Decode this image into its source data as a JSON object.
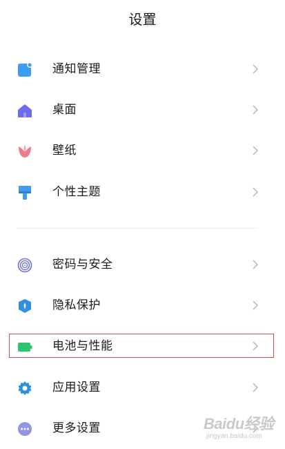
{
  "header": {
    "title": "设置"
  },
  "settings": {
    "items": [
      {
        "label": "通知管理",
        "icon": "notification-icon",
        "color": "#3d9bf2"
      },
      {
        "label": "桌面",
        "icon": "home-icon",
        "color": "#6c6cf0"
      },
      {
        "label": "壁纸",
        "icon": "tulip-icon",
        "color": "#f07a8a"
      },
      {
        "label": "个性主题",
        "icon": "brush-icon",
        "color": "#3d9bf2"
      },
      {
        "label": "密码与安全",
        "icon": "fingerprint-icon",
        "color": "#7a7fd0"
      },
      {
        "label": "隐私保护",
        "icon": "privacy-shield-icon",
        "color": "#2f8fe0"
      },
      {
        "label": "电池与性能",
        "icon": "battery-icon",
        "color": "#2fc46f"
      },
      {
        "label": "应用设置",
        "icon": "gear-icon",
        "color": "#2f8fe0"
      },
      {
        "label": "更多设置",
        "icon": "more-icon",
        "color": "#8f96e8"
      }
    ]
  },
  "watermark": {
    "brand": "Baidu经验",
    "url": "jingyan.baidu.com"
  },
  "colors": {
    "highlight": "#d0454f",
    "chevron": "#b5b5b5",
    "divider": "#ececec"
  }
}
